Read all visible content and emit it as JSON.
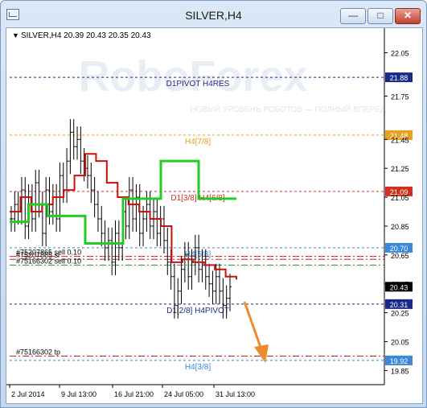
{
  "window": {
    "title": "SILVER,H4",
    "buttons": {
      "minimize": "—",
      "maximize": "□",
      "close": "✕"
    }
  },
  "chart_info": "SILVER,H4  20.39 20.43 20.35 20.43",
  "watermark": {
    "brand": "RoboForex",
    "tagline": "НОВЫЙ УРОВЕНЬ РОБОТОВ — ПОЛНЫЙ ВПЕРЕД"
  },
  "colors": {
    "pivot": "#1a2a8a",
    "resistance": "#e8a020",
    "murrey": "#d03020",
    "support": "#3a88d8",
    "green": "#22cc22",
    "red": "#cc1010",
    "arrow": "#f08a30"
  },
  "chart_data": {
    "type": "candlestick",
    "symbol": "SILVER",
    "timeframe": "H4",
    "ohlc_current": {
      "open": 20.39,
      "high": 20.43,
      "low": 20.35,
      "close": 20.43
    },
    "ylim": [
      19.78,
      22.12
    ],
    "y_ticks": [
      "22.05",
      "21.75",
      "21.45",
      "21.25",
      "21.05",
      "20.85",
      "20.65",
      "20.45",
      "20.25",
      "20.05",
      "19.85"
    ],
    "x_ticks": [
      "2 Jul 2014",
      "9 Jul 13:00",
      "16 Jul 21:00",
      "24 Jul 05:00",
      "31 Jul 13:00"
    ],
    "close_series": [
      20.9,
      21.0,
      20.95,
      21.1,
      20.85,
      21.05,
      20.9,
      21.15,
      21.0,
      20.8,
      21.1,
      20.95,
      21.05,
      20.9,
      21.2,
      21.1,
      21.3,
      21.5,
      21.4,
      21.45,
      21.3,
      21.25,
      21.2,
      21.1,
      21.0,
      20.9,
      20.8,
      20.7,
      20.75,
      20.6,
      20.8,
      20.7,
      20.95,
      20.85,
      21.1,
      20.9,
      21.05,
      20.8,
      20.9,
      21.0,
      20.85,
      20.95,
      20.8,
      20.9,
      20.75,
      20.6,
      20.5,
      20.3,
      20.4,
      20.55,
      20.65,
      20.5,
      20.6,
      20.7,
      20.55,
      20.6,
      20.5,
      20.45,
      20.4,
      20.5,
      20.4,
      20.3,
      20.35,
      20.43
    ],
    "levels": [
      {
        "label": "D1PIVOT H4RES",
        "price": 21.88,
        "tag": "21.88",
        "style": "pivot"
      },
      {
        "label": "H4[7/8]",
        "price": 21.48,
        "tag": "21.48",
        "style": "resistance"
      },
      {
        "label": "D1[3/8] H4[6/8]",
        "price": 21.09,
        "tag": "21.09",
        "style": "murrey"
      },
      {
        "label": "H4[5/8]",
        "price": 20.7,
        "tag": "20.70",
        "style": "support"
      },
      {
        "label": "D1[2/8] H4PIVOT",
        "price": 20.31,
        "tag": "20.31",
        "style": "pivot"
      },
      {
        "label": "H4[3/8]",
        "price": 19.92,
        "tag": "19.92",
        "style": "support"
      }
    ],
    "orders": [
      {
        "label": "#75207865 sell 0.10",
        "price": 20.64
      },
      {
        "label": "#75207865 sl",
        "price": 20.62
      },
      {
        "label": "#75166302 sell 0.10",
        "price": 20.58
      },
      {
        "label": "#75166302 tp",
        "price": 19.95
      }
    ],
    "current_price_tag": "20.43"
  }
}
